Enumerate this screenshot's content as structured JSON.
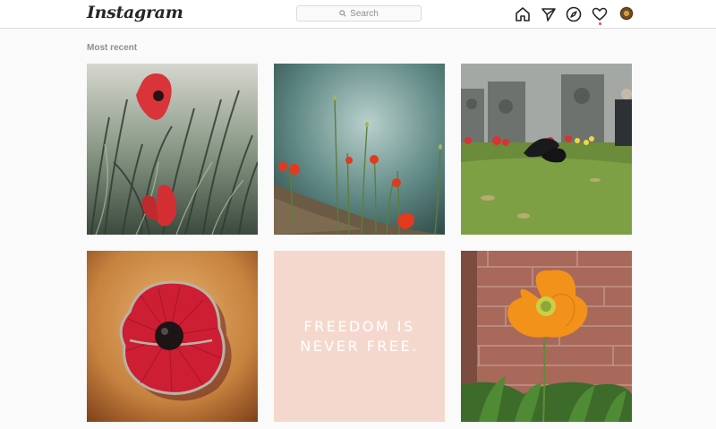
{
  "header": {
    "logo_text": "Instagram",
    "search_placeholder": "Search",
    "icons": [
      "home-icon",
      "direct-icon",
      "explore-icon",
      "activity-icon",
      "profile-avatar"
    ]
  },
  "feed": {
    "section_title": "Most recent",
    "posts": [
      {
        "name": "post-poppies-in-grass",
        "description": "Red poppies among tall grass"
      },
      {
        "name": "post-poppies-by-water",
        "description": "Poppies by misty water"
      },
      {
        "name": "post-memorial-crows",
        "description": "Memorial wall with wreaths and crows"
      },
      {
        "name": "post-poppy-pin",
        "description": "Red enamel poppy pin"
      },
      {
        "name": "post-freedom-quote",
        "quote_line1": "FREEDOM IS",
        "quote_line2": "NEVER FREE."
      },
      {
        "name": "post-orange-poppy",
        "description": "Orange poppy by brick wall"
      }
    ]
  },
  "colors": {
    "background": "#fafafa",
    "header_bg": "#ffffff",
    "border": "#dbdbdb",
    "muted_text": "#8e8e8e",
    "notification": "#ed4956",
    "quote_tile_bg": "#f5d8cd"
  }
}
